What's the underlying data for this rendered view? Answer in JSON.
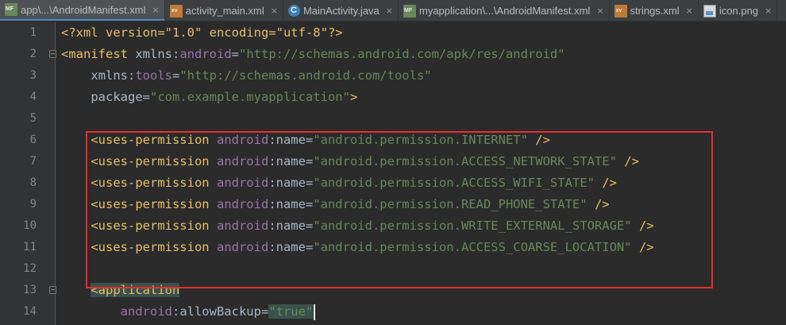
{
  "tabs": [
    {
      "label": "app\\...\\AndroidManifest.xml",
      "icon": "manifest-file-icon",
      "active": true
    },
    {
      "label": "activity_main.xml",
      "icon": "layout-xml-file-icon",
      "active": false
    },
    {
      "label": "MainActivity.java",
      "icon": "java-class-icon",
      "active": false
    },
    {
      "label": "myapplication\\...\\AndroidManifest.xml",
      "icon": "manifest-file-icon",
      "active": false
    },
    {
      "label": "strings.xml",
      "icon": "values-xml-file-icon",
      "active": false
    },
    {
      "label": "icon.png",
      "icon": "image-file-icon",
      "active": false
    }
  ],
  "tab_close_glyph": "×",
  "editor": {
    "line_numbers": [
      "1",
      "2",
      "3",
      "4",
      "5",
      "6",
      "7",
      "8",
      "9",
      "10",
      "11",
      "12",
      "13",
      "14"
    ],
    "lines": [
      [
        {
          "t": "pi",
          "v": "<?xml version=\"1.0\" encoding=\"utf-8\"?>"
        }
      ],
      [
        {
          "t": "tag",
          "v": "<manifest"
        },
        {
          "t": "plain",
          "v": " xmlns:"
        },
        {
          "t": "ns",
          "v": "android"
        },
        {
          "t": "plain",
          "v": "="
        },
        {
          "t": "val",
          "v": "\"http://schemas.android.com/apk/res/android\""
        }
      ],
      [
        {
          "t": "plain",
          "v": "    xmlns:"
        },
        {
          "t": "ns",
          "v": "tools"
        },
        {
          "t": "plain",
          "v": "="
        },
        {
          "t": "val",
          "v": "\"http://schemas.android.com/tools\""
        }
      ],
      [
        {
          "t": "plain",
          "v": "    package="
        },
        {
          "t": "val",
          "v": "\"com.example.myapplication\""
        },
        {
          "t": "tag",
          "v": ">"
        }
      ],
      [],
      [
        {
          "t": "plain",
          "v": "    "
        },
        {
          "t": "tag",
          "v": "<uses-permission"
        },
        {
          "t": "plain",
          "v": " "
        },
        {
          "t": "ns",
          "v": "android"
        },
        {
          "t": "plain",
          "v": ":name="
        },
        {
          "t": "val",
          "v": "\"android.permission.INTERNET\""
        },
        {
          "t": "plain",
          "v": " "
        },
        {
          "t": "tag",
          "v": "/>"
        }
      ],
      [
        {
          "t": "plain",
          "v": "    "
        },
        {
          "t": "tag",
          "v": "<uses-permission"
        },
        {
          "t": "plain",
          "v": " "
        },
        {
          "t": "ns",
          "v": "android"
        },
        {
          "t": "plain",
          "v": ":name="
        },
        {
          "t": "val",
          "v": "\"android.permission.ACCESS_NETWORK_STATE\""
        },
        {
          "t": "plain",
          "v": " "
        },
        {
          "t": "tag",
          "v": "/>"
        }
      ],
      [
        {
          "t": "plain",
          "v": "    "
        },
        {
          "t": "tag",
          "v": "<uses-permission"
        },
        {
          "t": "plain",
          "v": " "
        },
        {
          "t": "ns",
          "v": "android"
        },
        {
          "t": "plain",
          "v": ":name="
        },
        {
          "t": "val",
          "v": "\"android.permission.ACCESS_WIFI_STATE\""
        },
        {
          "t": "plain",
          "v": " "
        },
        {
          "t": "tag",
          "v": "/>"
        }
      ],
      [
        {
          "t": "plain",
          "v": "    "
        },
        {
          "t": "tag",
          "v": "<uses-permission"
        },
        {
          "t": "plain",
          "v": " "
        },
        {
          "t": "ns",
          "v": "android"
        },
        {
          "t": "plain",
          "v": ":name="
        },
        {
          "t": "val",
          "v": "\"android.permission.READ_PHONE_STATE\""
        },
        {
          "t": "plain",
          "v": " "
        },
        {
          "t": "tag",
          "v": "/>"
        }
      ],
      [
        {
          "t": "plain",
          "v": "    "
        },
        {
          "t": "tag",
          "v": "<uses-permission"
        },
        {
          "t": "plain",
          "v": " "
        },
        {
          "t": "ns",
          "v": "android"
        },
        {
          "t": "plain",
          "v": ":name="
        },
        {
          "t": "val",
          "v": "\"android.permission.WRITE_EXTERNAL_STORAGE\""
        },
        {
          "t": "plain",
          "v": " "
        },
        {
          "t": "tag",
          "v": "/>"
        }
      ],
      [
        {
          "t": "plain",
          "v": "    "
        },
        {
          "t": "tag",
          "v": "<uses-permission"
        },
        {
          "t": "plain",
          "v": " "
        },
        {
          "t": "ns",
          "v": "android"
        },
        {
          "t": "plain",
          "v": ":name="
        },
        {
          "t": "val",
          "v": "\"android.permission.ACCESS_COARSE_LOCATION\""
        },
        {
          "t": "plain",
          "v": " "
        },
        {
          "t": "tag",
          "v": "/>"
        }
      ],
      [],
      [
        {
          "t": "plain",
          "v": "    "
        },
        {
          "t": "tagmatch",
          "v": "<application"
        }
      ],
      [
        {
          "t": "plain",
          "v": "        "
        },
        {
          "t": "ns",
          "v": "android"
        },
        {
          "t": "plain",
          "v": ":allowBackup="
        },
        {
          "t": "valmatch",
          "v": "\"true\""
        }
      ]
    ],
    "fold_markers_on_lines": [
      2,
      13
    ]
  },
  "colors": {
    "background": "#2b2b2b",
    "tag": "#e8bf6a",
    "attribute": "#a9b7c6",
    "namespace": "#9876aa",
    "string_value": "#6a8759",
    "highlight_border": "#e5302d"
  }
}
